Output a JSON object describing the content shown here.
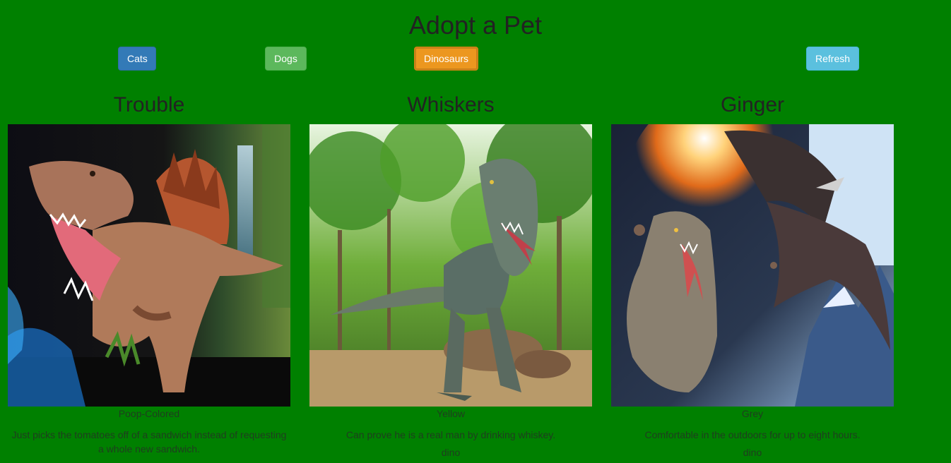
{
  "page": {
    "title": "Adopt a Pet"
  },
  "toolbar": {
    "cats_label": "Cats",
    "dogs_label": "Dogs",
    "dinosaurs_label": "Dinosaurs",
    "refresh_label": "Refresh"
  },
  "pets": [
    {
      "name": "Trouble",
      "color": "Poop-Colored",
      "description": "Just picks the tomatoes off of a sandwich instead of requesting a whole new sandwich.",
      "type": ""
    },
    {
      "name": "Whiskers",
      "color": "Yellow",
      "description": "Can prove he is a real man by drinking whiskey.",
      "type": "dino"
    },
    {
      "name": "Ginger",
      "color": "Grey",
      "description": "Comfortable in the outdoors for up to eight hours.",
      "type": "dino"
    }
  ],
  "colors": {
    "background": "#008000",
    "cats_button": "#337ab7",
    "dogs_button": "#5cb85c",
    "dinosaurs_button": "#ec971f",
    "refresh_button": "#5bc0de"
  }
}
